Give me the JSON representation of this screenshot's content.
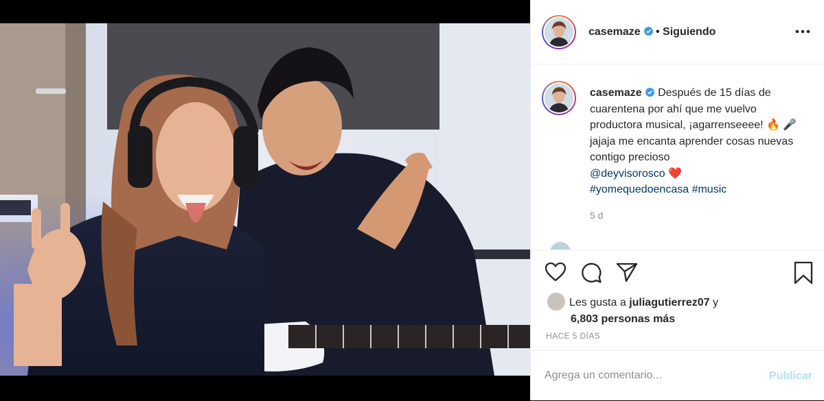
{
  "post": {
    "username": "casemaze",
    "follow_status": "• Siguiendo",
    "caption_text": "Después de 15 días de cuarentena por ahí que me vuelvo productora musical, ¡agarrenseeee! 🔥 🎤 jajaja me encanta aprender cosas nuevas contigo precioso",
    "mention": "@deyvisorosco",
    "heart_emoji": "❤️",
    "hashtag_1": "#yomequedoencasa",
    "hashtag_2": "#music",
    "time_ago": "5 d"
  },
  "likes": {
    "prefix": "Les gusta a",
    "liker": "juliagutierrez07",
    "suffix": "y",
    "others": "6,803 personas más"
  },
  "date_label": "HACE 5 DÍAS",
  "comment": {
    "placeholder": "Agrega un comentario...",
    "publish_label": "Publicar"
  },
  "icons": [
    "verified-badge-icon",
    "more-options-icon",
    "heart-icon",
    "comment-icon",
    "share-icon",
    "bookmark-icon"
  ],
  "colors": {
    "verified": "#3897f0",
    "link": "#00376b",
    "publish_disabled": "#b2dffc",
    "muted": "#8e8e8e"
  }
}
